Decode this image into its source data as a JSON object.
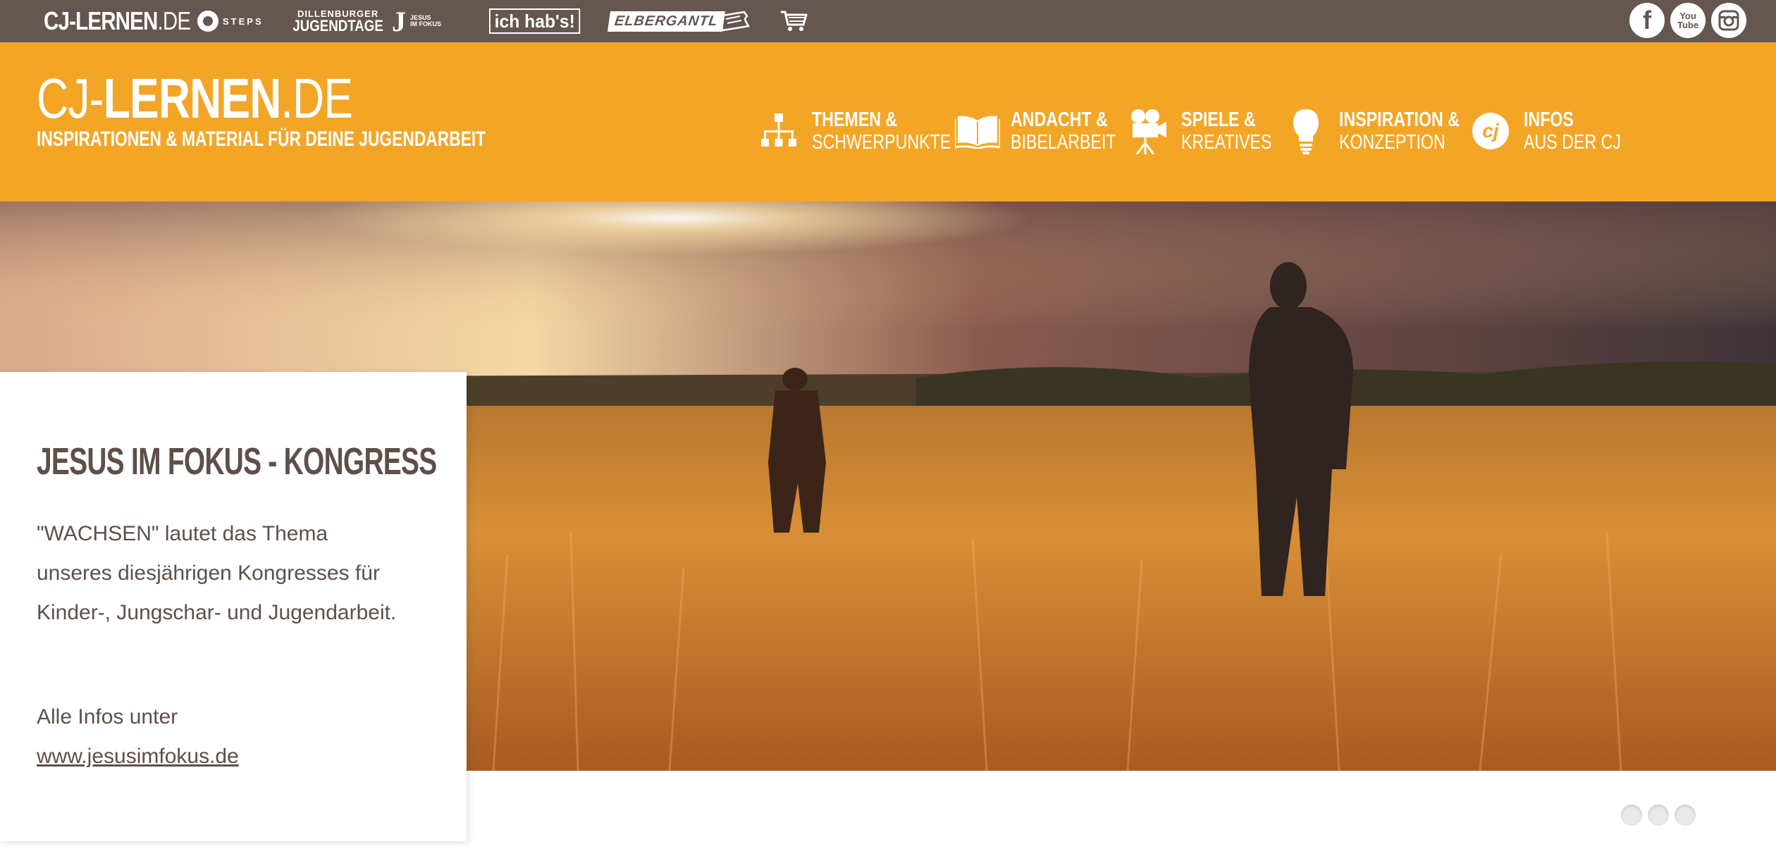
{
  "network_bar": {
    "cj_logo": {
      "bold": "CJ-LERNEN",
      "thin": ".DE"
    },
    "steps_logo": "STEPS",
    "dbjt_logo": {
      "line1": "DILLENBURGER",
      "line2": "JUGENDTAGE"
    },
    "jif_logo": {
      "letter": "J",
      "line1": "JESUS",
      "line2": "IM FOKUS"
    },
    "ichhabs_logo": "ich hab's!",
    "elbergantl_logo": "ELBERGANTL",
    "ticket_icon": "ticket-icon",
    "cart_icon": "shopping-cart-icon",
    "social": [
      {
        "name": "facebook-icon",
        "glyph": "f"
      },
      {
        "name": "youtube-icon",
        "glyph": "You Tube"
      },
      {
        "name": "instagram-icon",
        "glyph": ""
      }
    ]
  },
  "header": {
    "brand_prefix": "CJ-",
    "brand_bold": "LERNEN",
    "brand_suffix": ".DE",
    "brand_sub": "INSPIRATIONEN & MATERIAL FÜR DEINE JUGENDARBEIT",
    "nav": [
      {
        "l1": "THEMEN &",
        "l2": "SCHWERPUNKTE",
        "icon": "sitemap-icon"
      },
      {
        "l1": "ANDACHT &",
        "l2": "BIBELARBEIT",
        "icon": "open-book-icon"
      },
      {
        "l1": "SPIELE &",
        "l2": "KREATIVES",
        "icon": "film-camera-icon"
      },
      {
        "l1": "INSPIRATION &",
        "l2": "KONZEPTION",
        "icon": "lightbulb-icon"
      },
      {
        "l1": "INFOS",
        "l2": "AUS DER CJ",
        "icon": "cj-badge-icon",
        "badge_text": "cj"
      }
    ]
  },
  "hero": {
    "title": "JESUS IM FOKUS - KONGRESS",
    "text1": "\"WACHSEN\" lautet das Thema unseres diesjährigen Kongresses für Kinder-, Jungschar- und Jugendarbeit.",
    "text2_prefix": "Alle Infos unter",
    "link": "www.jesusimfokus.de",
    "slides": 3,
    "colors": {
      "orange": "#f3a626",
      "brown": "#655650",
      "text": "#5e5049"
    }
  }
}
